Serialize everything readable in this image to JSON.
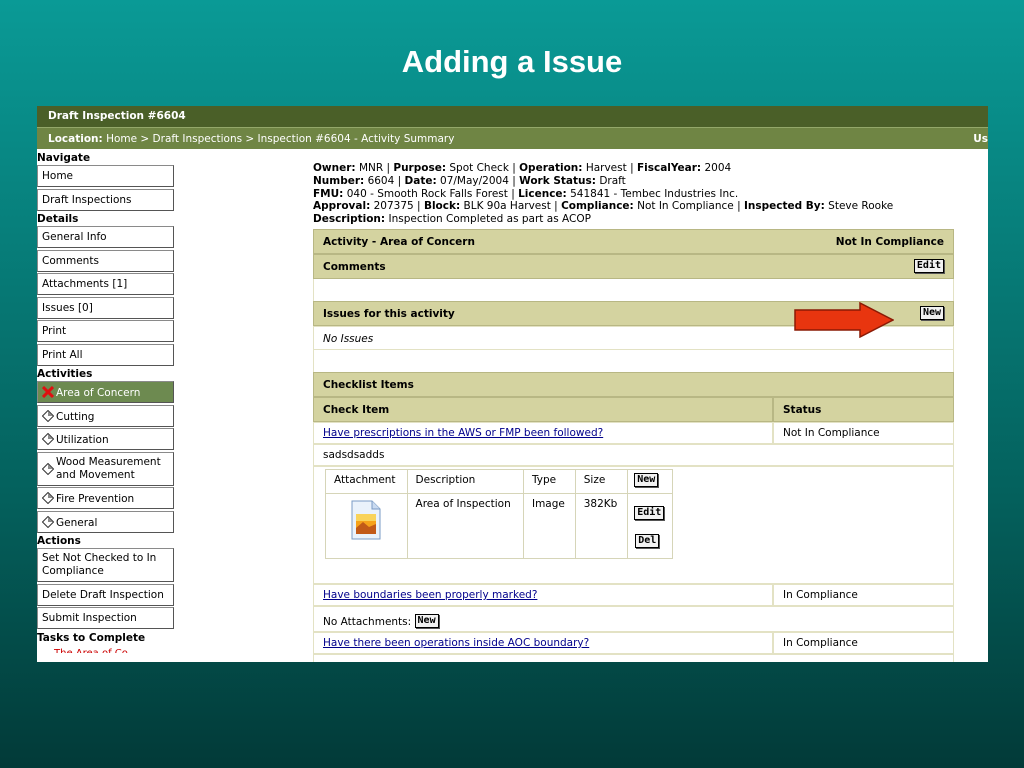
{
  "slide": {
    "title": "Adding a Issue"
  },
  "app": {
    "header_title": "Draft Inspection #6604",
    "location_label": "Location:",
    "location_path": "Home > Draft Inspections > Inspection #6604 - Activity Summary",
    "user_clip": "Us"
  },
  "sidebar": {
    "navigate_label": "Navigate",
    "navigate": [
      "Home",
      "Draft Inspections"
    ],
    "details_label": "Details",
    "details": [
      "General Info",
      "Comments",
      "Attachments [1]",
      "Issues [0]",
      "Print",
      "Print All"
    ],
    "activities_label": "Activities",
    "activities": [
      {
        "label": "Area of Concern",
        "icon": "x-icon",
        "active": true
      },
      {
        "label": "Cutting",
        "icon": "diamond-icon"
      },
      {
        "label": "Utilization",
        "icon": "diamond-icon"
      },
      {
        "label": "Wood Measurement and Movement",
        "line1": "Wood Measurement",
        "line2": "and Movement",
        "icon": "diamond-icon"
      },
      {
        "label": "Fire Prevention",
        "icon": "diamond-icon"
      },
      {
        "label": "General",
        "icon": "diamond-icon"
      }
    ],
    "actions_label": "Actions",
    "actions": [
      {
        "line1": "Set Not Checked to In",
        "line2": "Compliance"
      },
      {
        "label": "Delete Draft Inspection"
      },
      {
        "label": "Submit Inspection"
      }
    ],
    "tasks_label": "Tasks to Complete",
    "tasks_note": "The Area of Co..."
  },
  "meta": {
    "owner_label": "Owner:",
    "owner": "MNR",
    "purpose_label": "Purpose:",
    "purpose": "Spot Check",
    "operation_label": "Operation:",
    "operation": "Harvest",
    "fiscal_label": "FiscalYear:",
    "fiscal": "2004",
    "number_label": "Number:",
    "number": "6604",
    "date_label": "Date:",
    "date": "07/May/2004",
    "work_label": "Work Status:",
    "work": "Draft",
    "fmu_label": "FMU:",
    "fmu": "040 - Smooth Rock Falls Forest",
    "licence_label": "Licence:",
    "licence": "541841 - Tembec Industries Inc.",
    "approval_label": "Approval:",
    "approval": "207375",
    "block_label": "Block:",
    "block": "BLK 90a Harvest",
    "compliance_label": "Compliance:",
    "compliance": "Not In Compliance",
    "inspected_label": "Inspected By:",
    "inspected": "Steve Rooke",
    "desc_label": "Description:",
    "desc": "Inspection Completed as part as ACOP"
  },
  "panel": {
    "activity_title": "Activity - Area of Concern",
    "activity_status": "Not In Compliance",
    "comments_title": "Comments",
    "edit_label": "Edit",
    "issues_title": "Issues for this activity",
    "new_label": "New",
    "no_issues": "No Issues",
    "checklist_title": "Checklist Items",
    "col_item": "Check Item",
    "col_status": "Status",
    "items": [
      {
        "q": "Have prescriptions in the AWS or FMP been followed?",
        "status": "Not In Compliance"
      },
      {
        "q": "Have boundaries been properly marked?",
        "status": "In Compliance"
      },
      {
        "q": "Have there been operations inside AOC boundary?",
        "status": "In Compliance"
      }
    ],
    "comment_text": "sadsdsadds",
    "attach_headers": [
      "Attachment",
      "Description",
      "Type",
      "Size"
    ],
    "attach_row": {
      "description": "Area of Inspection",
      "type": "Image",
      "size": "382Kb"
    },
    "del_label": "Del",
    "no_attachments": "No Attachments:"
  },
  "colors": {
    "header_dark": "#4a5f28",
    "header_light": "#6f8544",
    "bar": "#d4d3a0",
    "arrow": "#e8350f"
  }
}
